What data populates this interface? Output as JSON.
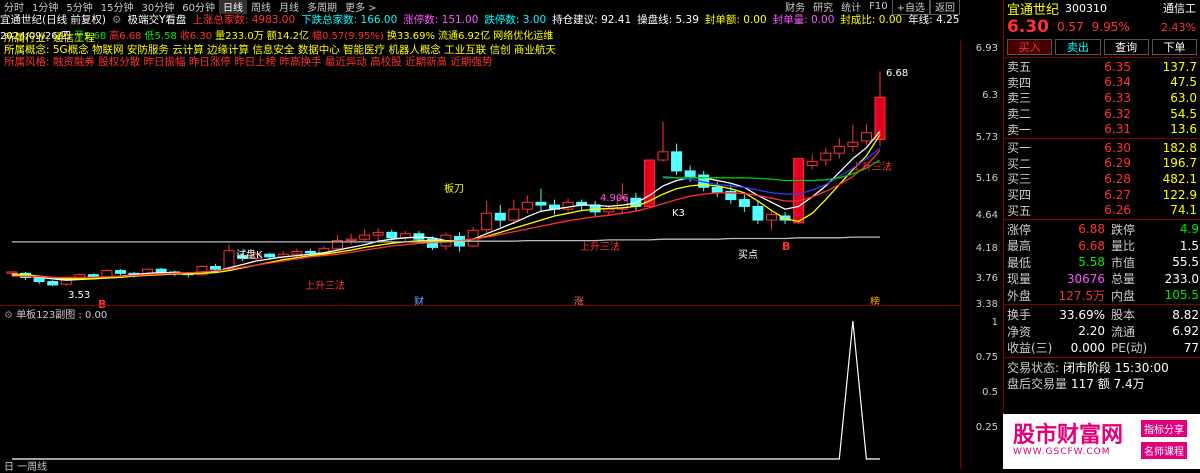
{
  "toolbar": {
    "periods": [
      "分时",
      "1分钟",
      "5分钟",
      "15分钟",
      "30分钟",
      "60分钟",
      "日线",
      "周线",
      "月线",
      "多周期",
      "更多 >"
    ],
    "active_index": 6,
    "right_items": [
      "财务",
      "研究",
      "统计",
      "F10"
    ],
    "extra_buttons": [
      "+自选",
      "返回"
    ]
  },
  "title": {
    "stock": "宜通世纪(日线 前复权)",
    "indicator": "极端交Y看盘",
    "up_total": "上涨总家数: 4983.00",
    "down_total": "下跌总家数: 166.00",
    "limit_up": "涨停数: 151.00",
    "limit_down": "跌停数: 3.00",
    "hold_advice": "持仓建议: 92.41",
    "operation_line": "操盘线: 5.39",
    "seal_amount": "封单额: 0.00",
    "seal_volume": "封单量: 0.00",
    "seal_ratio": "封成比: 0.00",
    "year_line": "年线: 4.25"
  },
  "info": {
    "date": "2024/09/26/四",
    "open": "开5.68",
    "high": "高6.68",
    "low": "低5.58",
    "close": "收6.30",
    "volume": "量233.0万",
    "amount": "额14.2亿",
    "amplitude": "幅0.57(9.95%)",
    "turnover": "换33.69%",
    "float": "流通6.92亿",
    "concept": "网络优化运维"
  },
  "chart_notes": {
    "industry": "所属行业: 通信工程",
    "concepts": "所属概念: 5G概念 物联网 安防服务 云计算 边缘计算 信息安全 数据中心 智能医疗 机器人概念 工业互联 信创 商业航天",
    "style": "所属风格: 融资融券 股权分散 昨日振幅 昨日涨停 昨日上榜 昨高换手 最近异动 高校股 近期新高 近期强势",
    "annotations": [
      "上升三法",
      "上升三法",
      "上升三法",
      "试盘K",
      "板刀",
      "K3",
      "买点",
      "B",
      "B",
      "4.906",
      "3.53",
      "6.68",
      "财",
      "涨",
      "榜"
    ]
  },
  "chart_data": {
    "type": "candlestick",
    "y_ticks": [
      6.93,
      6.3,
      5.73,
      5.16,
      4.64,
      4.18,
      3.76,
      3.38
    ],
    "ylim": [
      3.3,
      7.05
    ],
    "candles": [
      [
        3.72,
        3.74,
        3.68,
        3.75
      ],
      [
        3.72,
        3.66,
        3.62,
        3.74
      ],
      [
        3.66,
        3.6,
        3.56,
        3.68
      ],
      [
        3.6,
        3.55,
        3.53,
        3.62
      ],
      [
        3.56,
        3.64,
        3.54,
        3.66
      ],
      [
        3.64,
        3.7,
        3.62,
        3.72
      ],
      [
        3.7,
        3.66,
        3.63,
        3.72
      ],
      [
        3.67,
        3.76,
        3.65,
        3.78
      ],
      [
        3.76,
        3.72,
        3.69,
        3.78
      ],
      [
        3.72,
        3.7,
        3.66,
        3.74
      ],
      [
        3.7,
        3.78,
        3.68,
        3.8
      ],
      [
        3.78,
        3.74,
        3.7,
        3.8
      ],
      [
        3.74,
        3.72,
        3.68,
        3.76
      ],
      [
        3.72,
        3.7,
        3.66,
        3.74
      ],
      [
        3.7,
        3.82,
        3.68,
        3.84
      ],
      [
        3.82,
        3.78,
        3.75,
        3.86
      ],
      [
        3.78,
        4.05,
        3.76,
        4.14
      ],
      [
        3.98,
        3.94,
        3.9,
        4.02
      ],
      [
        3.94,
        4.0,
        3.92,
        4.02
      ],
      [
        4.0,
        3.96,
        3.92,
        4.02
      ],
      [
        3.96,
        4.0,
        3.94,
        4.04
      ],
      [
        4.0,
        4.04,
        3.96,
        4.08
      ],
      [
        4.04,
        4.02,
        3.98,
        4.08
      ],
      [
        4.02,
        4.08,
        4.0,
        4.12
      ],
      [
        4.08,
        4.2,
        4.06,
        4.28
      ],
      [
        4.2,
        4.22,
        4.14,
        4.3
      ],
      [
        4.22,
        4.28,
        4.18,
        4.36
      ],
      [
        4.28,
        4.32,
        4.2,
        4.38
      ],
      [
        4.32,
        4.24,
        4.2,
        4.36
      ],
      [
        4.24,
        4.3,
        4.18,
        4.34
      ],
      [
        4.3,
        4.22,
        4.16,
        4.34
      ],
      [
        4.22,
        4.1,
        4.06,
        4.26
      ],
      [
        4.12,
        4.28,
        4.06,
        4.32
      ],
      [
        4.26,
        4.12,
        4.04,
        4.32
      ],
      [
        4.12,
        4.35,
        4.1,
        4.4
      ],
      [
        4.36,
        4.6,
        4.3,
        4.78
      ],
      [
        4.6,
        4.5,
        4.4,
        4.72
      ],
      [
        4.5,
        4.66,
        4.44,
        4.8
      ],
      [
        4.66,
        4.76,
        4.6,
        4.86
      ],
      [
        4.76,
        4.72,
        4.62,
        4.96
      ],
      [
        4.72,
        4.66,
        4.58,
        4.8
      ],
      [
        4.66,
        4.76,
        4.62,
        4.82
      ],
      [
        4.76,
        4.72,
        4.64,
        4.8
      ],
      [
        4.72,
        4.62,
        4.56,
        4.78
      ],
      [
        4.62,
        4.66,
        4.56,
        4.72
      ],
      [
        4.66,
        4.82,
        4.6,
        5.04
      ],
      [
        4.82,
        4.7,
        4.64,
        4.9
      ],
      [
        4.7,
        5.38,
        4.68,
        5.38
      ],
      [
        5.38,
        5.5,
        5.36,
        5.94
      ],
      [
        5.5,
        5.22,
        5.16,
        5.62
      ],
      [
        5.22,
        5.14,
        5.06,
        5.3
      ],
      [
        5.16,
        4.98,
        4.92,
        5.22
      ],
      [
        4.98,
        4.9,
        4.84,
        5.06
      ],
      [
        4.92,
        4.8,
        4.74,
        5.02
      ],
      [
        4.8,
        4.7,
        4.62,
        4.88
      ],
      [
        4.7,
        4.5,
        4.44,
        4.78
      ],
      [
        4.5,
        4.58,
        4.36,
        4.62
      ],
      [
        4.56,
        4.5,
        4.44,
        4.62
      ],
      [
        4.46,
        5.4,
        4.44,
        5.4
      ],
      [
        5.3,
        5.36,
        5.24,
        5.46
      ],
      [
        5.38,
        5.48,
        5.3,
        5.56
      ],
      [
        5.48,
        5.58,
        5.4,
        5.7
      ],
      [
        5.58,
        5.64,
        5.5,
        5.9
      ],
      [
        5.66,
        5.78,
        5.6,
        5.9
      ],
      [
        5.68,
        6.3,
        5.58,
        6.68
      ]
    ],
    "ma_lines": [
      {
        "color": "#ffffff",
        "values": [
          3.7,
          3.68,
          3.66,
          3.64,
          3.62,
          3.63,
          3.64,
          3.66,
          3.68,
          3.7,
          3.72,
          3.73,
          3.73,
          3.72,
          3.74,
          3.75,
          3.8,
          3.85,
          3.9,
          3.93,
          3.96,
          3.98,
          4.0,
          4.02,
          4.06,
          4.1,
          4.14,
          4.19,
          4.22,
          4.24,
          4.25,
          4.24,
          4.2,
          4.2,
          4.22,
          4.3,
          4.38,
          4.46,
          4.55,
          4.63,
          4.66,
          4.69,
          4.72,
          4.72,
          4.7,
          4.72,
          4.75,
          4.86,
          5.0,
          5.08,
          5.12,
          5.12,
          5.08,
          5.04,
          4.98,
          4.86,
          4.76,
          4.66,
          4.7,
          4.84,
          5.0,
          5.2,
          5.4,
          5.56,
          5.8
        ]
      },
      {
        "color": "#ffff00",
        "values": [
          3.71,
          3.7,
          3.68,
          3.66,
          3.64,
          3.64,
          3.64,
          3.65,
          3.66,
          3.68,
          3.69,
          3.7,
          3.71,
          3.71,
          3.72,
          3.73,
          3.76,
          3.8,
          3.84,
          3.88,
          3.92,
          3.95,
          3.98,
          4.0,
          4.03,
          4.06,
          4.1,
          4.13,
          4.16,
          4.18,
          4.2,
          4.2,
          4.2,
          4.2,
          4.22,
          4.26,
          4.32,
          4.38,
          4.44,
          4.5,
          4.56,
          4.6,
          4.64,
          4.66,
          4.67,
          4.68,
          4.7,
          4.78,
          4.88,
          4.96,
          5.0,
          5.02,
          5.0,
          4.96,
          4.9,
          4.78,
          4.64,
          4.52,
          4.48,
          4.6,
          4.8,
          5.02,
          5.24,
          5.44,
          5.75
        ]
      },
      {
        "color": "#ff3030",
        "values": [
          3.68,
          3.68,
          3.67,
          3.66,
          3.66,
          3.66,
          3.66,
          3.67,
          3.68,
          3.69,
          3.7,
          3.71,
          3.72,
          3.73,
          3.74,
          3.76,
          3.78,
          3.81,
          3.84,
          3.87,
          3.9,
          3.93,
          3.96,
          3.98,
          4.0,
          4.03,
          4.06,
          4.09,
          4.12,
          4.14,
          4.16,
          4.17,
          4.18,
          4.2,
          4.22,
          4.25,
          4.29,
          4.33,
          4.37,
          4.41,
          4.45,
          4.49,
          4.52,
          4.55,
          4.57,
          4.6,
          4.63,
          4.68,
          4.74,
          4.8,
          4.85,
          4.88,
          4.9,
          4.9,
          4.89,
          4.86,
          4.82,
          4.78,
          4.78,
          4.84,
          4.92,
          5.02,
          5.14,
          5.3,
          5.52
        ]
      },
      {
        "color": "#3838ff",
        "values": [
          null,
          null,
          null,
          null,
          null,
          null,
          null,
          null,
          null,
          null,
          null,
          null,
          null,
          null,
          null,
          null,
          null,
          null,
          null,
          null,
          null,
          null,
          null,
          null,
          null,
          null,
          null,
          null,
          null,
          null,
          null,
          null,
          null,
          null,
          null,
          null,
          null,
          null,
          null,
          null,
          null,
          null,
          null,
          null,
          null,
          null,
          null,
          null,
          5.14,
          5.12,
          5.1,
          5.06,
          5.02,
          5.0,
          4.98,
          4.94,
          4.9,
          4.88,
          4.88,
          4.94,
          5.02,
          5.14,
          5.26,
          5.4,
          5.55
        ]
      },
      {
        "color": "#00cc00",
        "values": [
          null,
          null,
          null,
          null,
          null,
          null,
          null,
          null,
          null,
          null,
          null,
          null,
          null,
          null,
          null,
          null,
          null,
          null,
          null,
          null,
          null,
          null,
          null,
          null,
          null,
          null,
          null,
          null,
          null,
          null,
          null,
          null,
          null,
          null,
          null,
          null,
          null,
          null,
          null,
          null,
          null,
          null,
          null,
          null,
          null,
          null,
          null,
          null,
          5.12,
          5.12,
          5.12,
          5.12,
          5.12,
          5.12,
          5.12,
          5.11,
          5.1,
          5.08,
          5.08,
          5.08,
          5.09,
          5.12,
          5.18,
          5.26,
          5.38
        ]
      },
      {
        "color": "#bbbbbb",
        "values": [
          4.18,
          4.18,
          4.18,
          4.18,
          4.18,
          4.18,
          4.18,
          4.18,
          4.18,
          4.18,
          4.18,
          4.18,
          4.18,
          4.18,
          4.18,
          4.18,
          4.18,
          4.18,
          4.18,
          4.18,
          4.18,
          4.18,
          4.18,
          4.18,
          4.18,
          4.18,
          4.18,
          4.18,
          4.18,
          4.18,
          4.18,
          4.18,
          4.18,
          4.19,
          4.19,
          4.19,
          4.19,
          4.19,
          4.2,
          4.2,
          4.2,
          4.2,
          4.2,
          4.2,
          4.21,
          4.21,
          4.21,
          4.21,
          4.22,
          4.22,
          4.22,
          4.22,
          4.22,
          4.23,
          4.23,
          4.23,
          4.23,
          4.23,
          4.24,
          4.24,
          4.24,
          4.24,
          4.25,
          4.25,
          4.25
        ]
      }
    ],
    "sub_indicator": {
      "title": "单板123副图 : 0.00",
      "y_ticks": [
        1.0,
        0.75,
        0.5,
        0.25,
        0.0
      ],
      "values": [
        0,
        0,
        0,
        0,
        0,
        0,
        0,
        0,
        0,
        0,
        0,
        0,
        0,
        0,
        0,
        0,
        0,
        0,
        0,
        0,
        0,
        0,
        0,
        0,
        0,
        0,
        0,
        0,
        0,
        0,
        0,
        0,
        0,
        0,
        0,
        0,
        0,
        0,
        0,
        0,
        0,
        0,
        0,
        0,
        0,
        0,
        0,
        0,
        0,
        0,
        0,
        0,
        0,
        0,
        0,
        0,
        0,
        0,
        0,
        0,
        0,
        0,
        1,
        0,
        0
      ]
    }
  },
  "quote": {
    "name": "宜通世纪",
    "code": "300310",
    "price": "6.30",
    "change": "0.57",
    "pct": "9.95%",
    "side_name": "通信工",
    "side_pct": "2.43%",
    "buttons": [
      "买入",
      "卖出",
      "查询",
      "下单"
    ],
    "asks": [
      {
        "label": "卖五",
        "price": "6.35",
        "vol": "137.7"
      },
      {
        "label": "卖四",
        "price": "6.34",
        "vol": "47.5"
      },
      {
        "label": "卖三",
        "price": "6.33",
        "vol": "63.0"
      },
      {
        "label": "卖二",
        "price": "6.32",
        "vol": "54.5"
      },
      {
        "label": "卖一",
        "price": "6.31",
        "vol": "13.6"
      }
    ],
    "bids": [
      {
        "label": "买一",
        "price": "6.30",
        "vol": "182.8"
      },
      {
        "label": "买二",
        "price": "6.29",
        "vol": "196.7"
      },
      {
        "label": "买三",
        "price": "6.28",
        "vol": "482.1"
      },
      {
        "label": "买四",
        "price": "6.27",
        "vol": "122.9"
      },
      {
        "label": "买五",
        "price": "6.26",
        "vol": "74.1"
      }
    ],
    "stats": [
      {
        "l1": "涨停",
        "v1": "6.88",
        "l2": "跌停",
        "v2": "4.9",
        "c1": "red",
        "c2": "green"
      },
      {
        "l1": "最高",
        "v1": "6.68",
        "l2": "量比",
        "v2": "1.5",
        "c1": "red",
        "c2": "white"
      },
      {
        "l1": "最低",
        "v1": "5.58",
        "l2": "市值",
        "v2": "55.5",
        "c1": "green",
        "c2": "white"
      },
      {
        "l1": "现量",
        "v1": "30676",
        "l2": "总量",
        "v2": "233.0",
        "c1": "magenta",
        "c2": "white"
      },
      {
        "l1": "外盘",
        "v1": "127.5万",
        "l2": "内盘",
        "v2": "105.5",
        "c1": "red",
        "c2": "green"
      }
    ],
    "stats2": [
      {
        "l1": "换手",
        "v1": "33.69%",
        "l2": "股本",
        "v2": "8.82"
      },
      {
        "l1": "净资",
        "v1": "2.20",
        "l2": "流通",
        "v2": "6.92"
      },
      {
        "l1": "收益(三)",
        "v1": "0.000",
        "l2": "PE(动)",
        "v2": "77"
      }
    ],
    "status_label": "交易状态:",
    "status_value": "闭市阶段 15:30:00",
    "after_label": "盘后交易量",
    "after_value": "117 额 7.4万"
  },
  "ad": {
    "logo": "股市财富网",
    "url": "WWW.GSCFW.COM",
    "tag1": "指标分享",
    "tag2": "名师课程"
  },
  "bottom_text": "日 一周线"
}
